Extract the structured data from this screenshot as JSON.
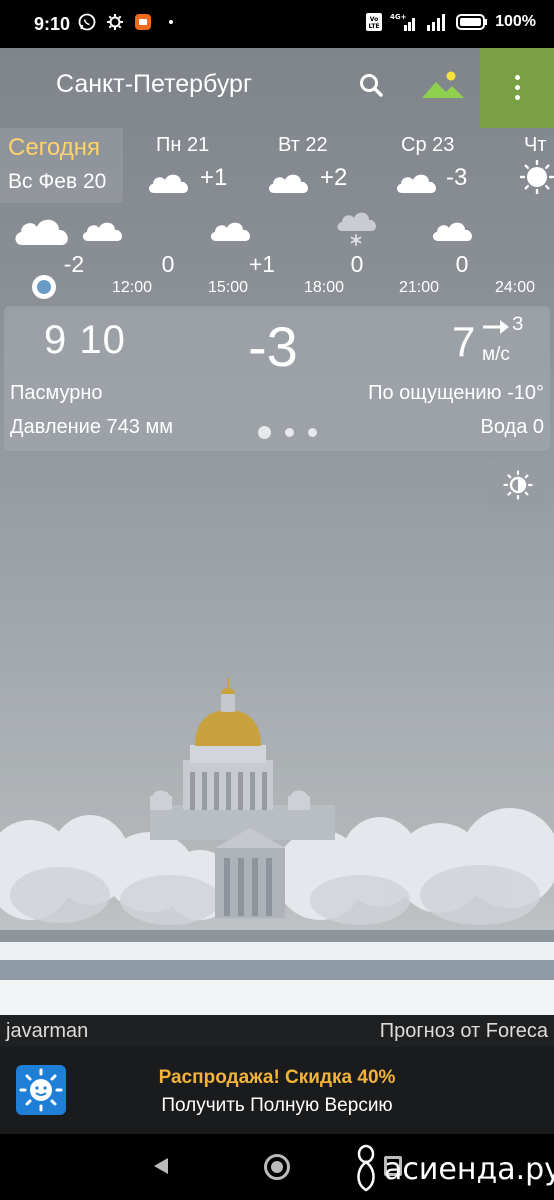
{
  "status_bar": {
    "time": "9:10",
    "battery": "100%",
    "network": "4G+",
    "icons": [
      "whatsapp-icon",
      "settings-icon",
      "app-icon",
      "dot-icon",
      "volte-icon",
      "signal-icon",
      "battery-icon"
    ]
  },
  "header": {
    "city": "Санкт-Петербург",
    "menu_color": "#7aa044"
  },
  "days": {
    "today": {
      "label": "Сегодня",
      "date": "Вс Фев 20"
    },
    "items": [
      {
        "name": "Пн 21",
        "temp": "+1",
        "icon": "cloud-icon"
      },
      {
        "name": "Вт 22",
        "temp": "+2",
        "icon": "cloud-icon"
      },
      {
        "name": "Ср 23",
        "temp": "-3",
        "icon": "cloud-icon"
      },
      {
        "name": "Чт",
        "temp": "",
        "icon": "sun-icon"
      }
    ]
  },
  "hourly": {
    "temps": [
      "-2",
      "0",
      "+1",
      "0",
      "0"
    ],
    "times": [
      "12:00",
      "15:00",
      "18:00",
      "21:00",
      "24:00"
    ]
  },
  "current": {
    "time": "9 10",
    "temp": "-3",
    "wind_speed": "7",
    "wind_dir": "З",
    "wind_unit": "м/с",
    "condition": "Пасмурно",
    "feels_like": "По ощущению -10°",
    "pressure": "Давление 743 мм",
    "water": "Вода 0",
    "page_index": 1,
    "page_count": 3
  },
  "credits": {
    "author": "javarman",
    "provider": "Прогноз от Foreca"
  },
  "promo": {
    "title": "Распродажа! Скидка 40%",
    "subtitle": "Получить Полную Версию",
    "title_color": "#f2b33a"
  },
  "watermark": {
    "text": "асиенда.ру"
  }
}
